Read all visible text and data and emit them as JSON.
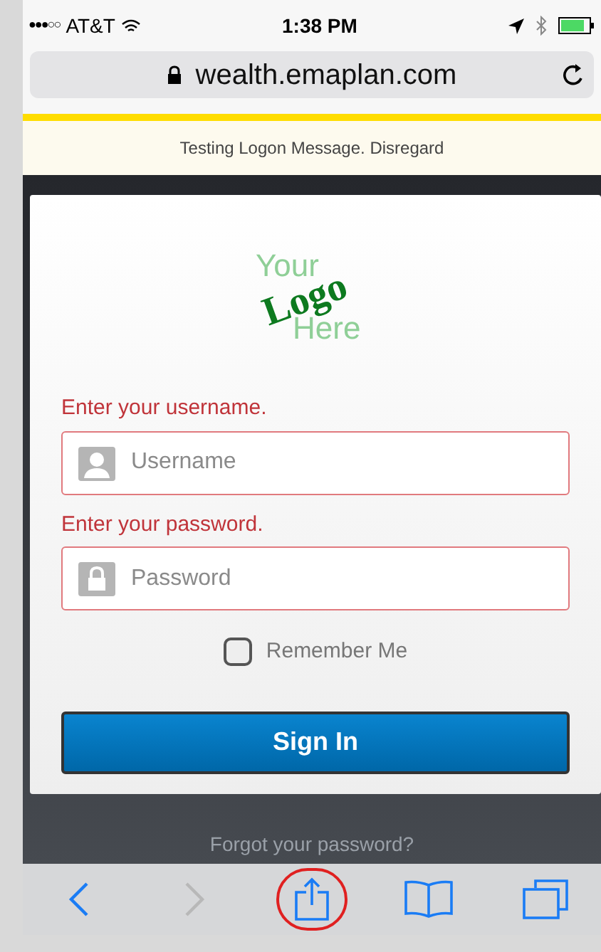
{
  "status_bar": {
    "signal_bars": "●●●○○",
    "carrier": "AT&T",
    "time": "1:38 PM"
  },
  "address_bar": {
    "url": "wealth.emaplan.com"
  },
  "banner": {
    "message": "Testing Logon Message. Disregard"
  },
  "logo": {
    "line_1": "Your",
    "line_2": "Logo",
    "line_3": "Here"
  },
  "form": {
    "fields": [
      {
        "error": "Enter your username.",
        "placeholder": "Username",
        "kind": "user"
      },
      {
        "error": "Enter your password.",
        "placeholder": "Password",
        "kind": "lock"
      }
    ],
    "remember": {
      "label": "Remember Me",
      "checked": false
    },
    "submit": "Sign In"
  },
  "forgot_link": "Forgot your password?",
  "toolbar": [
    {
      "kind": "back",
      "disabled": false,
      "circled": false
    },
    {
      "kind": "forward",
      "disabled": true,
      "circled": false
    },
    {
      "kind": "share",
      "disabled": false,
      "circled": true
    },
    {
      "kind": "bookmarks",
      "disabled": false,
      "circled": false
    },
    {
      "kind": "tabs",
      "disabled": false,
      "circled": false
    }
  ]
}
